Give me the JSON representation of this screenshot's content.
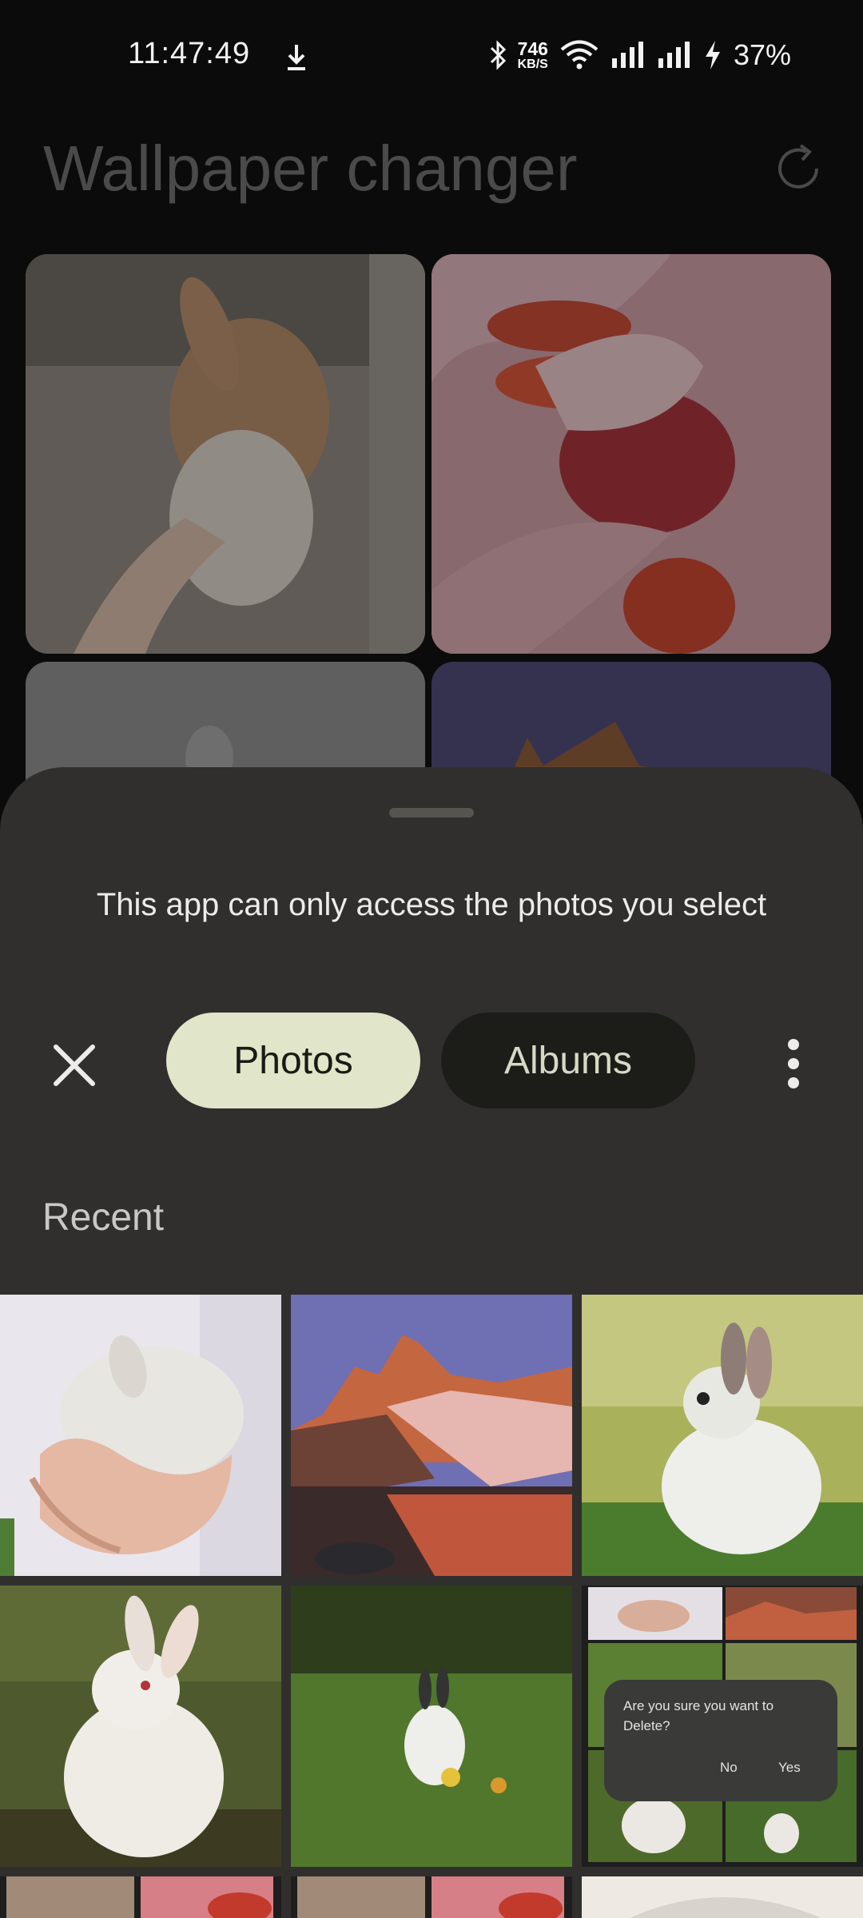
{
  "status_bar": {
    "time": "11:47:49",
    "net_speed_value": "746",
    "net_speed_unit": "KB/S",
    "battery": "37%",
    "icons": [
      "download-icon",
      "bluetooth-icon",
      "wifi-icon",
      "signal-icon",
      "signal-icon",
      "charging-icon"
    ]
  },
  "app": {
    "title": "Wallpaper changer",
    "refresh_icon": "refresh-icon"
  },
  "picker": {
    "prompt": "This app can only access the photos you select",
    "tabs": [
      {
        "label": "Photos",
        "selected": true
      },
      {
        "label": "Albums",
        "selected": false
      }
    ],
    "close_icon": "close-icon",
    "more_icon": "more-vert-icon",
    "section": "Recent"
  },
  "dialog_in_screenshot": {
    "message": "Are you sure you want to Delete?",
    "no": "No",
    "yes": "Yes"
  },
  "colors": {
    "sheet_bg": "#302f2d",
    "tab_selected_bg": "#e1e5c9",
    "tab_unselected_bg": "#1c1d18"
  }
}
